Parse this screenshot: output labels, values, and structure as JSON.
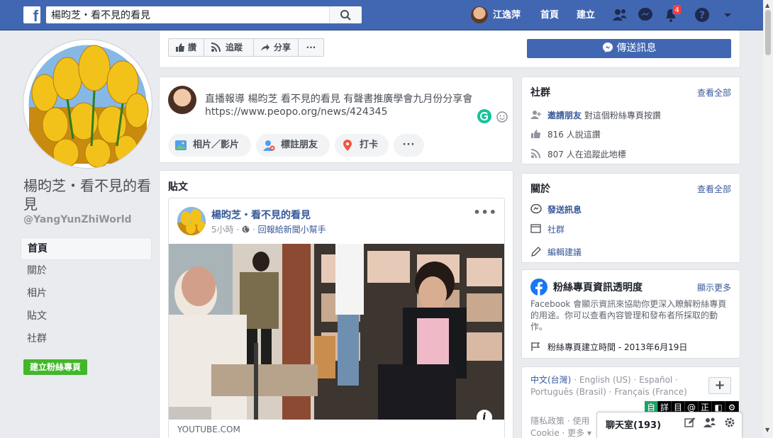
{
  "topbar": {
    "search_value": "楊昀芝・看不見的看見",
    "user_name": "江逸萍",
    "home": "首頁",
    "create": "建立",
    "notification_count": "4"
  },
  "page": {
    "name": "楊昀芝・看不見的看見",
    "handle": "@YangYunZhiWorld",
    "create_page_button": "建立粉絲專頁"
  },
  "left_nav": [
    "首頁",
    "關於",
    "相片",
    "貼文",
    "社群"
  ],
  "action_bar": {
    "like": "讚",
    "follow": "追蹤",
    "share": "分享",
    "more": "···",
    "send_message": "傳送訊息"
  },
  "composer": {
    "text": "直播報導 楊昀芝 看不見的看見 有聲書推廣學會九月份分享會 https://www.peopo.org/news/424345",
    "photo_video": "相片／影片",
    "tag_friends": "標註朋友",
    "check_in": "打卡",
    "more": "···"
  },
  "posts_section": {
    "title": "貼文",
    "post": {
      "author": "楊昀芝・看不見的看見",
      "time": "5小時",
      "shared_via": "回報給新聞小幫手",
      "link_domain": "YOUTUBE.COM"
    }
  },
  "community": {
    "title": "社群",
    "see_all": "查看全部",
    "invite_link": "邀請朋友",
    "invite_text": "對這個粉絲專頁按讚",
    "likes": "816 人說這讚",
    "follows": "807 人在追蹤此地標"
  },
  "about": {
    "title": "關於",
    "see_all": "查看全部",
    "send_message": "發送訊息",
    "community": "社群",
    "suggest_edit": "編輯建議"
  },
  "transparency": {
    "title": "粉絲專頁資訊透明度",
    "see_more": "顯示更多",
    "description": "Facebook 會顯示資訊來協助你更深入瞭解粉絲專頁的用途。你可以查看內容管理和發布者所採取的動作。",
    "created": "粉絲專頁建立時間 - 2013年6月19日"
  },
  "languages": {
    "current": "中文(台灣)",
    "others": "· English (US) · Español · Português (Brasil) · Français (France)",
    "footer_line1": "隱私政策 · 使用",
    "footer_line2": "Cookie · 更多 ▾"
  },
  "ime_keys": [
    "自",
    "詳",
    "目",
    "@",
    "正",
    "◧",
    "⚙"
  ],
  "chat": {
    "label": "聊天室(193)"
  },
  "colors": {
    "fb_blue": "#4267b2",
    "link": "#365899",
    "green": "#42b72a",
    "notification": "#fa3e3e"
  }
}
